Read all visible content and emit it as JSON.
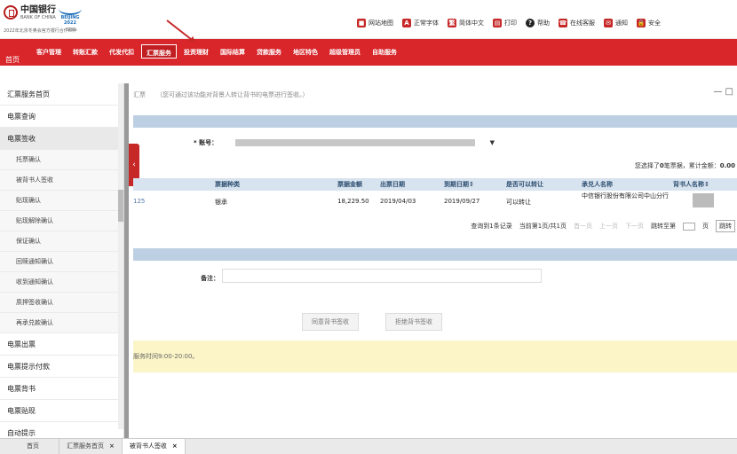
{
  "header": {
    "bank_name": "中国银行",
    "bank_name_en": "BANK OF CHINA",
    "bank_subtitle": "2022年北京冬奥会官方银行合作伙伴",
    "partner_name": "BEIJING 2022",
    "partner_rings": "ooo",
    "tools": [
      {
        "icon": "sitemap-icon",
        "glyph": "■",
        "label": "网站地图"
      },
      {
        "icon": "font-icon",
        "glyph": "A",
        "label": "正常字体"
      },
      {
        "icon": "language-icon",
        "glyph": "繁",
        "label": "简体中文"
      },
      {
        "icon": "print-icon",
        "glyph": "▤",
        "label": "打印"
      },
      {
        "icon": "help-icon",
        "glyph": "?",
        "label": "帮助"
      },
      {
        "icon": "service-icon",
        "glyph": "☎",
        "label": "在线客服"
      },
      {
        "icon": "notice-icon",
        "glyph": "✉",
        "label": "通知"
      },
      {
        "icon": "lock-icon",
        "glyph": "🔒",
        "label": "安全"
      }
    ]
  },
  "nav": {
    "home": "首页",
    "items": [
      "客户管理",
      "转账汇款",
      "代发代扣",
      "汇票服务",
      "投资理财",
      "国际结算",
      "贷款服务",
      "地区特色",
      "超级管理员",
      "自助服务"
    ],
    "active_index": 3
  },
  "sidebar": {
    "items": [
      {
        "label": "汇票服务首页",
        "type": "top"
      },
      {
        "label": "电票查询",
        "type": "top"
      },
      {
        "label": "电票签收",
        "type": "open"
      },
      {
        "label": "托票确认",
        "type": "sub"
      },
      {
        "label": "被背书人签收",
        "type": "sub"
      },
      {
        "label": "贴现确认",
        "type": "sub"
      },
      {
        "label": "贴现解除确认",
        "type": "sub"
      },
      {
        "label": "保证确认",
        "type": "sub"
      },
      {
        "label": "回赎通知确认",
        "type": "sub"
      },
      {
        "label": "收到通知确认",
        "type": "sub"
      },
      {
        "label": "质押签收确认",
        "type": "sub"
      },
      {
        "label": "再承兑款确认",
        "type": "sub"
      },
      {
        "label": "电票出票",
        "type": "top"
      },
      {
        "label": "电票提示付款",
        "type": "top"
      },
      {
        "label": "电票背书",
        "type": "top"
      },
      {
        "label": "电票贴现",
        "type": "top"
      },
      {
        "label": "自动提示",
        "type": "top"
      }
    ],
    "handle_glyph": "‹"
  },
  "main": {
    "crumb": "汇票",
    "crumb_tip": "（您可通过该功能对背景人转让背书的电票进行签收。）",
    "window_controls": "—  □",
    "account_label": "* 账号：",
    "account_caret": "▼",
    "summary_prefix": "您选择了",
    "summary_count": "0",
    "summary_mid": "笔票据，累计金额：",
    "summary_amount": "0.00",
    "columns": [
      "票据种类",
      "票据金额",
      "出票日期",
      "到期日期↕",
      "是否可以转让",
      "承兑人名称",
      "背书人名称↕"
    ],
    "row": {
      "id": "125",
      "type": "银承",
      "amount": "18,229.50",
      "issue_date": "2019/04/03",
      "due_date": "2019/09/27",
      "transferable": "可以转让",
      "acceptor": "中信银行股份有限公司中山分行"
    },
    "pager": {
      "summary": "查询到1条记录",
      "page_info": "当前第1页/共1页",
      "first": "首一页",
      "prev": "上一页",
      "next": "下一页",
      "jump": "跳转至第",
      "page_suffix": "页",
      "go": "跳转"
    },
    "note_label": "备注：",
    "buttons": [
      "同意背书签收",
      "拒绝背书签收"
    ],
    "notice": "服务时间9:00-20:00。"
  },
  "tabs": [
    {
      "label": "首页",
      "closable": false
    },
    {
      "label": "汇票服务首页",
      "closable": true
    },
    {
      "label": "被背书人签收",
      "closable": true
    }
  ],
  "colors": {
    "brand_red": "#d8262b",
    "band_blue": "#bdd0e3",
    "notice_yellow": "#fbf5c7"
  }
}
